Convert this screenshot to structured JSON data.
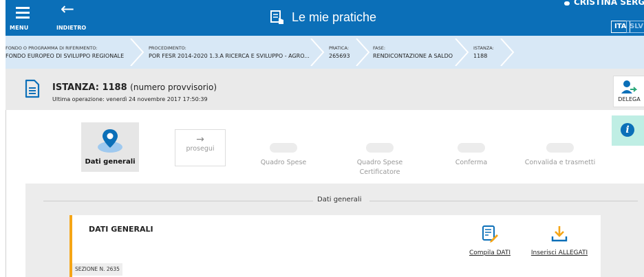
{
  "header": {
    "menu_label": "MENU",
    "back_label": "INDIETRO",
    "title": "Le mie pratiche",
    "user_name": "CRISTINA SERGA",
    "lang_active": "ITA",
    "lang_other": "SLV"
  },
  "breadcrumb": [
    {
      "key": "FONDO O PROGRAMMA DI RIFERIMENTO:",
      "value": "FONDO EUROPEO DI SVILUPPO REGIONALE"
    },
    {
      "key": "PROCEDIMENTO:",
      "value": "POR FESR 2014-2020 1.3.A RICERCA E SVILUPPO - AGRO..."
    },
    {
      "key": "PRATICA:",
      "value": "265693"
    },
    {
      "key": "FASE:",
      "value": "RENDICONTAZIONE A SALDO"
    },
    {
      "key": "ISTANZA:",
      "value": "1188"
    }
  ],
  "instance": {
    "title": "ISTANZA: 1188",
    "title_note": "(numero provvisorio)",
    "last_operation": "Ultima operazione: venerdì 24 novembre 2017 17:50:39",
    "delega_label": "DELEGA"
  },
  "steps": {
    "active": "Dati generali",
    "next": "prosegui",
    "items": [
      "Quadro Spese",
      "Quadro Spese Certificatore",
      "Conferma",
      "Convalida e trasmetti"
    ]
  },
  "section": {
    "title": "Dati generali",
    "card_title": "DATI GENERALI",
    "compile_label": "Compila DATI",
    "attach_label": "Inserisci ALLEGATI",
    "section_number": "SEZIONE N. 2635"
  },
  "colors": {
    "brand_blue": "#0b6fb8",
    "accent_orange": "#f5a516",
    "info_bg": "#bfeee4"
  }
}
